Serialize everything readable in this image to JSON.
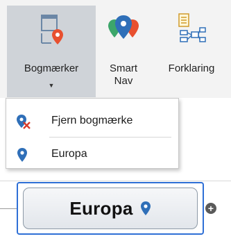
{
  "ribbon": {
    "buttons": [
      {
        "label": "Bogmærker",
        "icon": "bookmark-panel-icon",
        "active": true
      },
      {
        "label_line1": "Smart",
        "label_line2": "Nav",
        "icon": "smart-nav-pins-icon"
      },
      {
        "label": "Forklaring",
        "icon": "legend-diagram-icon"
      }
    ]
  },
  "menu": {
    "items": [
      {
        "label": "Fjern bogmærke",
        "icon": "remove-bookmark-icon"
      },
      {
        "label": "Europa",
        "icon": "map-pin-icon"
      }
    ]
  },
  "canvas": {
    "node_title": "Europa",
    "add_symbol": "+"
  },
  "colors": {
    "accent_blue": "#2e6fd6",
    "pin_blue": "#2f6fb8",
    "remove_red": "#d83b2b"
  }
}
